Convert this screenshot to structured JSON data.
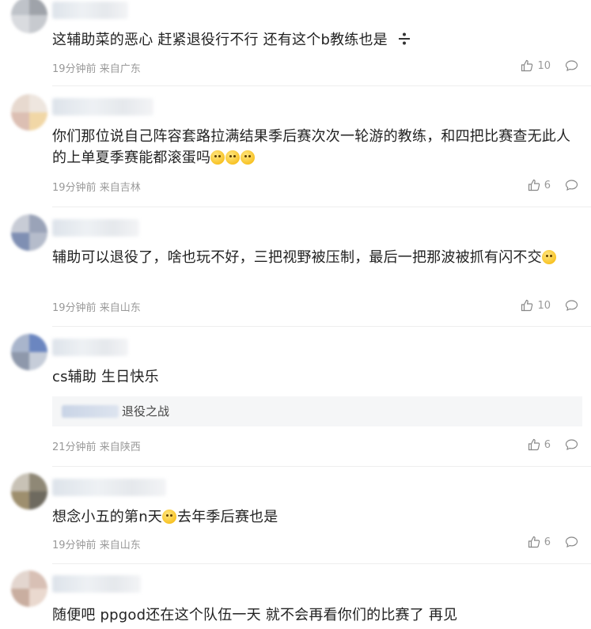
{
  "comments": [
    {
      "text": "这辅助菜的恶心 赶紧退役行不行 还有这个b教练也是 ",
      "time": "19分钟前",
      "location": "来自广东",
      "likes": "10"
    },
    {
      "text": "你们那位说自己阵容套路拉满结果季后赛次次一轮游的教练，和四把比赛查无此人的上单夏季赛能都滚蛋吗",
      "time": "19分钟前",
      "location": "来自吉林",
      "likes": "6"
    },
    {
      "text": "辅助可以退役了，啥也玩不好，三把视野被压制，最后一把那波被抓有闪不交",
      "time": "19分钟前",
      "location": "来自山东",
      "likes": "10"
    },
    {
      "text": "cs辅助 生日快乐",
      "quote": "退役之战",
      "time": "21分钟前",
      "location": "来自陕西",
      "likes": "6"
    },
    {
      "text_a": "想念小五的第n天",
      "text_b": "去年季后赛也是",
      "time": "19分钟前",
      "location": "来自山东",
      "likes": "6"
    },
    {
      "text": "随便吧 ppgod还在这个队伍一天 就不会再看你们的比赛了 再见"
    }
  ],
  "icons": {
    "like": "thumbs-up-icon",
    "reply": "comment-bubble-icon",
    "divide": "division-sign-icon",
    "emoji": "face-emoji-icon"
  },
  "colors": {
    "meta": "#999999",
    "text": "#222222",
    "divider": "#eeeeee",
    "quote_bg": "#f5f6f7"
  }
}
